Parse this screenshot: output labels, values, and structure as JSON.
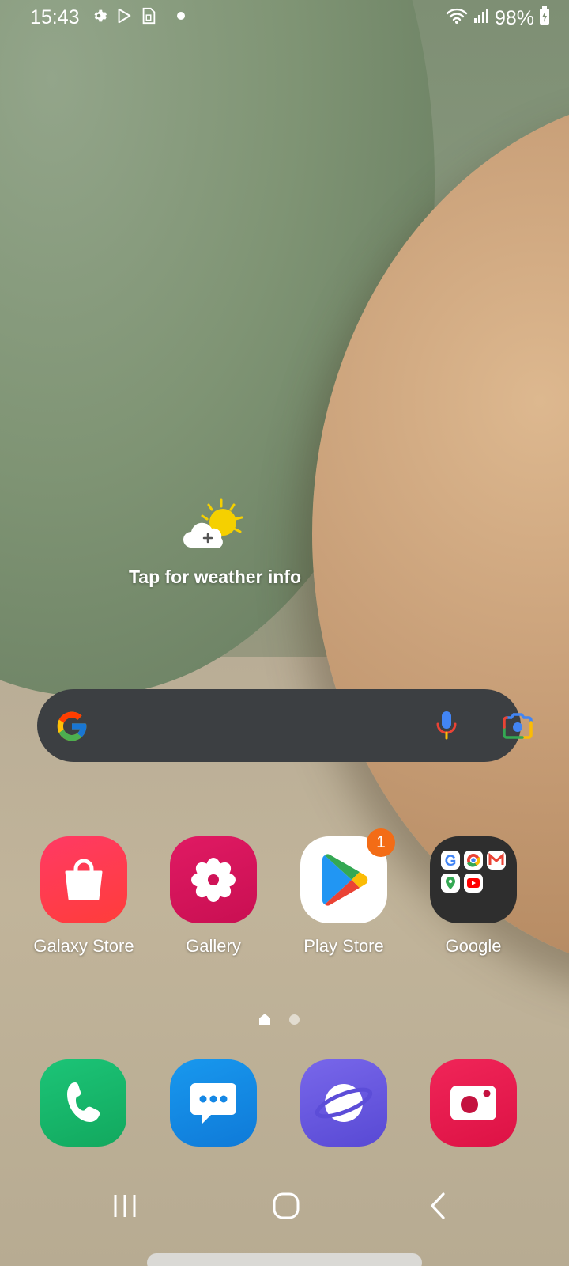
{
  "status_bar": {
    "time": "15:43",
    "battery": "98%",
    "icons": [
      "gear-icon",
      "play-triangle-icon",
      "sim-icon",
      "dot-icon",
      "wifi-icon",
      "signal-icon",
      "battery-charging-icon"
    ]
  },
  "weather": {
    "text": "Tap for weather info",
    "icon": "weather-sun-cloud-icon"
  },
  "search": {
    "icons": [
      "google-g-icon",
      "microphone-icon",
      "lens-camera-icon"
    ]
  },
  "apps": [
    {
      "label": "Galaxy Store",
      "icon": "shopping-bag-icon",
      "color": "#f03a5a"
    },
    {
      "label": "Gallery",
      "icon": "flower-icon",
      "color": "#d8185a"
    },
    {
      "label": "Play Store",
      "icon": "play-store-icon",
      "color": "#ffffff",
      "badge": "1"
    },
    {
      "label": "Google",
      "icon": "google-folder-icon",
      "color": "#2e2e2e"
    }
  ],
  "dock": [
    {
      "name": "Phone",
      "icon": "phone-icon",
      "color": "#19b36b"
    },
    {
      "name": "Messages",
      "icon": "message-icon",
      "color": "#1487e5"
    },
    {
      "name": "Internet",
      "icon": "planet-icon",
      "color": "#6b5fe0"
    },
    {
      "name": "Camera",
      "icon": "camera-icon",
      "color": "#ea1b4f"
    }
  ],
  "page_indicator": {
    "pages": 2,
    "current": 1
  },
  "nav": [
    "recents-icon",
    "home-icon",
    "back-icon"
  ],
  "colors": {
    "badge": "#f36c16",
    "search_bg": "#3c3f42"
  }
}
